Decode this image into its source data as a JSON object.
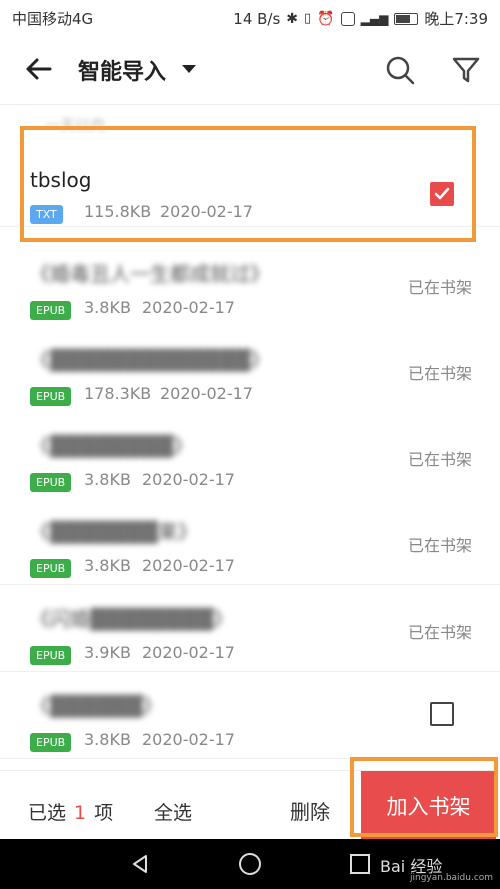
{
  "statusbar": {
    "carrier": "中国移动4G",
    "speed": "14 B/s",
    "time": "晚上7:39"
  },
  "appbar": {
    "title": "智能导入"
  },
  "section": {
    "label": "一天以内"
  },
  "files": [
    {
      "name": "tbslog",
      "type": "TXT",
      "size": "115.8KB",
      "date": "2020-02-17",
      "status": "",
      "checked": true
    },
    {
      "name": "《婚毒丑人一生都成就过》",
      "type": "EPUB",
      "size": "3.8KB",
      "date": "2020-02-17",
      "status": "已在书架",
      "checked": false
    },
    {
      "name": "《▓▓▓▓▓▓▓▓▓▓▓▓▓》",
      "type": "EPUB",
      "size": "178.3KB",
      "date": "2020-02-17",
      "status": "已在书架",
      "checked": false
    },
    {
      "name": "《▓▓▓▓▓▓▓▓》",
      "type": "EPUB",
      "size": "3.8KB",
      "date": "2020-02-17",
      "status": "已在书架",
      "checked": false
    },
    {
      "name": "《▓▓▓▓▓▓▓果》",
      "type": "EPUB",
      "size": "3.8KB",
      "date": "2020-02-17",
      "status": "已在书架",
      "checked": false
    },
    {
      "name": "《闪婚▓▓▓▓▓▓▓▓》",
      "type": "EPUB",
      "size": "3.9KB",
      "date": "2020-02-17",
      "status": "已在书架",
      "checked": false
    },
    {
      "name": "《▓▓▓▓▓▓》",
      "type": "EPUB",
      "size": "3.8KB",
      "date": "2020-02-17",
      "status": "",
      "checked": false
    }
  ],
  "bottombar": {
    "selected_prefix": "已选",
    "selected_count": "1",
    "selected_suffix": "项",
    "select_all": "全选",
    "delete": "删除",
    "add": "加入书架"
  },
  "watermark": {
    "text": "Bai 经验",
    "sub": "jingyan.baidu.com"
  },
  "colors": {
    "accent": "#e84c4c",
    "highlight": "#f29a3a",
    "txt_tag": "#5aa8f0",
    "epub_tag": "#3dad4a"
  }
}
